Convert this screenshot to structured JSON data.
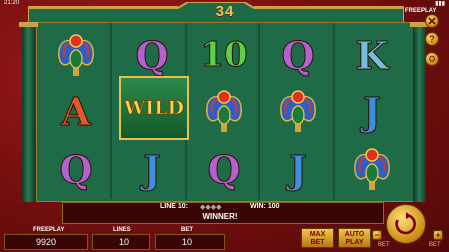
{
  "status_bar": {
    "time": "21:20",
    "battery": "▮▮▮"
  },
  "top": {
    "counter": "34",
    "freeplay_tag": "FREEPLAY"
  },
  "reels": [
    [
      "scarab",
      "A",
      "Q"
    ],
    [
      "Q",
      "WILD",
      "J"
    ],
    [
      "10",
      "scarab",
      "Q"
    ],
    [
      "Q",
      "scarab",
      "J"
    ],
    [
      "K",
      "J",
      "scarab"
    ]
  ],
  "wild_label": "WILD",
  "win_panel": {
    "line": "LINE 10:",
    "gems": "◆◆◆◆",
    "win": "WIN: 100",
    "message": "WINNER!"
  },
  "controls": {
    "freeplay_label": "FREEPLAY",
    "freeplay_value": "9920",
    "lines_label": "LINES",
    "lines_value": "10",
    "bet_label": "BET",
    "bet_value": "10",
    "max_bet": "MAX BET",
    "autoplay": "AUTO PLAY",
    "bet_side": "BET"
  },
  "colors": {
    "wild_gold": "#ffd34a",
    "felt": "#1f6b48",
    "accent": "#e8c256"
  },
  "side_icons": [
    "close-icon",
    "help-icon",
    "settings-icon"
  ]
}
